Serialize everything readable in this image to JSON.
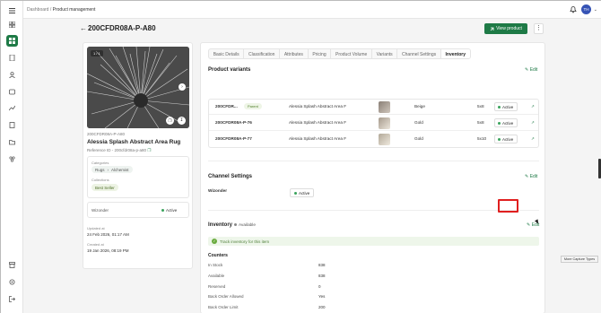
{
  "breadcrumb": {
    "root": "Dashboard",
    "separator": "/",
    "current": "Product management"
  },
  "user": {
    "initials": "TH"
  },
  "page": {
    "title": "200CFDR08A-P-A80",
    "view_product": "View product"
  },
  "product": {
    "sku": "200CFDR08A-P-A80",
    "name": "Alessia Splash Abstract Area Rug",
    "reference": "Reference ID - 200cfdr08a-p-a80",
    "categories_label": "Categories",
    "categories": [
      "Rugs",
      "Alchemist"
    ],
    "collections_label": "Collections",
    "collection": "Best Seller",
    "channel": "Wizonder",
    "channel_status": "Active",
    "updated_label": "Updated at",
    "updated": "24 Feb 2026, 01:17 AM",
    "created_label": "Created at",
    "created": "19 Jan 2026, 08:19 PM",
    "image_counter": "1 / 1"
  },
  "tabs": [
    "Basic Details",
    "Classification",
    "Attributes",
    "Pricing",
    "Product Volume",
    "Variants",
    "Channel Settings",
    "Inventory"
  ],
  "active_tab": "Inventory",
  "variants": {
    "title": "Product variants",
    "edit": "Edit",
    "rows": [
      {
        "sku": "200CFDR...",
        "badge": "Parent",
        "name": "Alessia Splash Abstract Area F",
        "color": "Beige",
        "size": "5x8",
        "status": "Active"
      },
      {
        "sku": "200CFDR08A-P-76",
        "badge": "",
        "name": "Alessia Splash Abstract Area F",
        "color": "Gold",
        "size": "5x8",
        "status": "Active"
      },
      {
        "sku": "200CFDR08A-P-77",
        "badge": "",
        "name": "Alessia Splash Abstract Area F",
        "color": "Gold",
        "size": "5x10",
        "status": "Active"
      }
    ]
  },
  "channel_settings": {
    "title": "Channel Settings",
    "edit": "Edit",
    "channel": "Wizonder",
    "status": "Active"
  },
  "inventory": {
    "title": "Inventory",
    "availability": "Available",
    "edit": "Edit",
    "track_message": "Track inventory for this item",
    "counters_title": "Counters",
    "counters": [
      {
        "label": "In Stock",
        "value": "838"
      },
      {
        "label": "Available",
        "value": "838"
      },
      {
        "label": "Reserved",
        "value": "0"
      },
      {
        "label": "Back Order Allowed",
        "value": "Yes"
      },
      {
        "label": "Back Order Limit",
        "value": "200"
      }
    ]
  },
  "tooltip": "More Capture Types",
  "colors": {
    "brand": "#1e7a46",
    "highlight": "#e01f1f",
    "active_dot": "#3aa35c"
  }
}
